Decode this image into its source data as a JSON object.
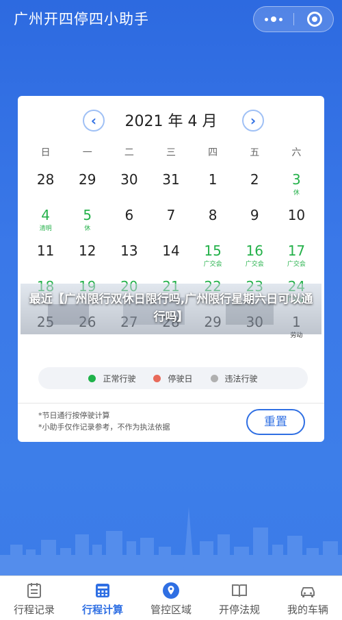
{
  "header": {
    "title": "广州开四停四小助手"
  },
  "calendar": {
    "month_title": "2021 年 4 月",
    "weekdays": [
      "日",
      "一",
      "二",
      "三",
      "四",
      "五",
      "六"
    ],
    "rows": [
      [
        {
          "d": "28",
          "t": "",
          "g": false
        },
        {
          "d": "29",
          "t": "",
          "g": false
        },
        {
          "d": "30",
          "t": "",
          "g": false
        },
        {
          "d": "31",
          "t": "",
          "g": false
        },
        {
          "d": "1",
          "t": "",
          "g": false
        },
        {
          "d": "2",
          "t": "",
          "g": false
        },
        {
          "d": "3",
          "t": "休",
          "g": true
        }
      ],
      [
        {
          "d": "4",
          "t": "清明",
          "g": true
        },
        {
          "d": "5",
          "t": "休",
          "g": true
        },
        {
          "d": "6",
          "t": "",
          "g": false
        },
        {
          "d": "7",
          "t": "",
          "g": false
        },
        {
          "d": "8",
          "t": "",
          "g": false
        },
        {
          "d": "9",
          "t": "",
          "g": false
        },
        {
          "d": "10",
          "t": "",
          "g": false
        }
      ],
      [
        {
          "d": "11",
          "t": "",
          "g": false
        },
        {
          "d": "12",
          "t": "",
          "g": false
        },
        {
          "d": "13",
          "t": "",
          "g": false
        },
        {
          "d": "14",
          "t": "",
          "g": false
        },
        {
          "d": "15",
          "t": "广交会",
          "g": true
        },
        {
          "d": "16",
          "t": "广交会",
          "g": true
        },
        {
          "d": "17",
          "t": "广交会",
          "g": true
        }
      ],
      [
        {
          "d": "18",
          "t": "",
          "g": true
        },
        {
          "d": "19",
          "t": "",
          "g": true
        },
        {
          "d": "20",
          "t": "",
          "g": true
        },
        {
          "d": "21",
          "t": "",
          "g": true
        },
        {
          "d": "22",
          "t": "",
          "g": true
        },
        {
          "d": "23",
          "t": "",
          "g": true
        },
        {
          "d": "24",
          "t": "广交会",
          "g": true
        }
      ],
      [
        {
          "d": "25",
          "t": "",
          "g": false
        },
        {
          "d": "26",
          "t": "",
          "g": false
        },
        {
          "d": "27",
          "t": "",
          "g": false
        },
        {
          "d": "28",
          "t": "",
          "g": false
        },
        {
          "d": "29",
          "t": "",
          "g": false
        },
        {
          "d": "30",
          "t": "",
          "g": false
        },
        {
          "d": "1",
          "t": "劳动",
          "g": false
        }
      ]
    ],
    "legend": [
      {
        "label": "正常行驶",
        "color": "#1fb24a"
      },
      {
        "label": "停驶日",
        "color": "#e86a5a"
      },
      {
        "label": "违法行驶",
        "color": "#b0b0b0"
      }
    ],
    "notes": [
      "*节日通行按停驶计算",
      "*小助手仅作记录参考，不作为执法依据"
    ],
    "reset_label": "重置"
  },
  "overlay": {
    "title": "最近【广州限行双休日限行吗,广州限行星期六日可以通行吗】"
  },
  "tabs": [
    {
      "label": "行程记录",
      "icon": "calendar-list-icon",
      "active": false
    },
    {
      "label": "行程计算",
      "icon": "calculator-icon",
      "active": true
    },
    {
      "label": "管控区域",
      "icon": "location-icon",
      "active": false
    },
    {
      "label": "开停法规",
      "icon": "book-icon",
      "active": false
    },
    {
      "label": "我的车辆",
      "icon": "car-icon",
      "active": false
    }
  ],
  "colors": {
    "primary": "#2f6fe3",
    "green": "#24b14a",
    "background": "#2f6ee0"
  }
}
